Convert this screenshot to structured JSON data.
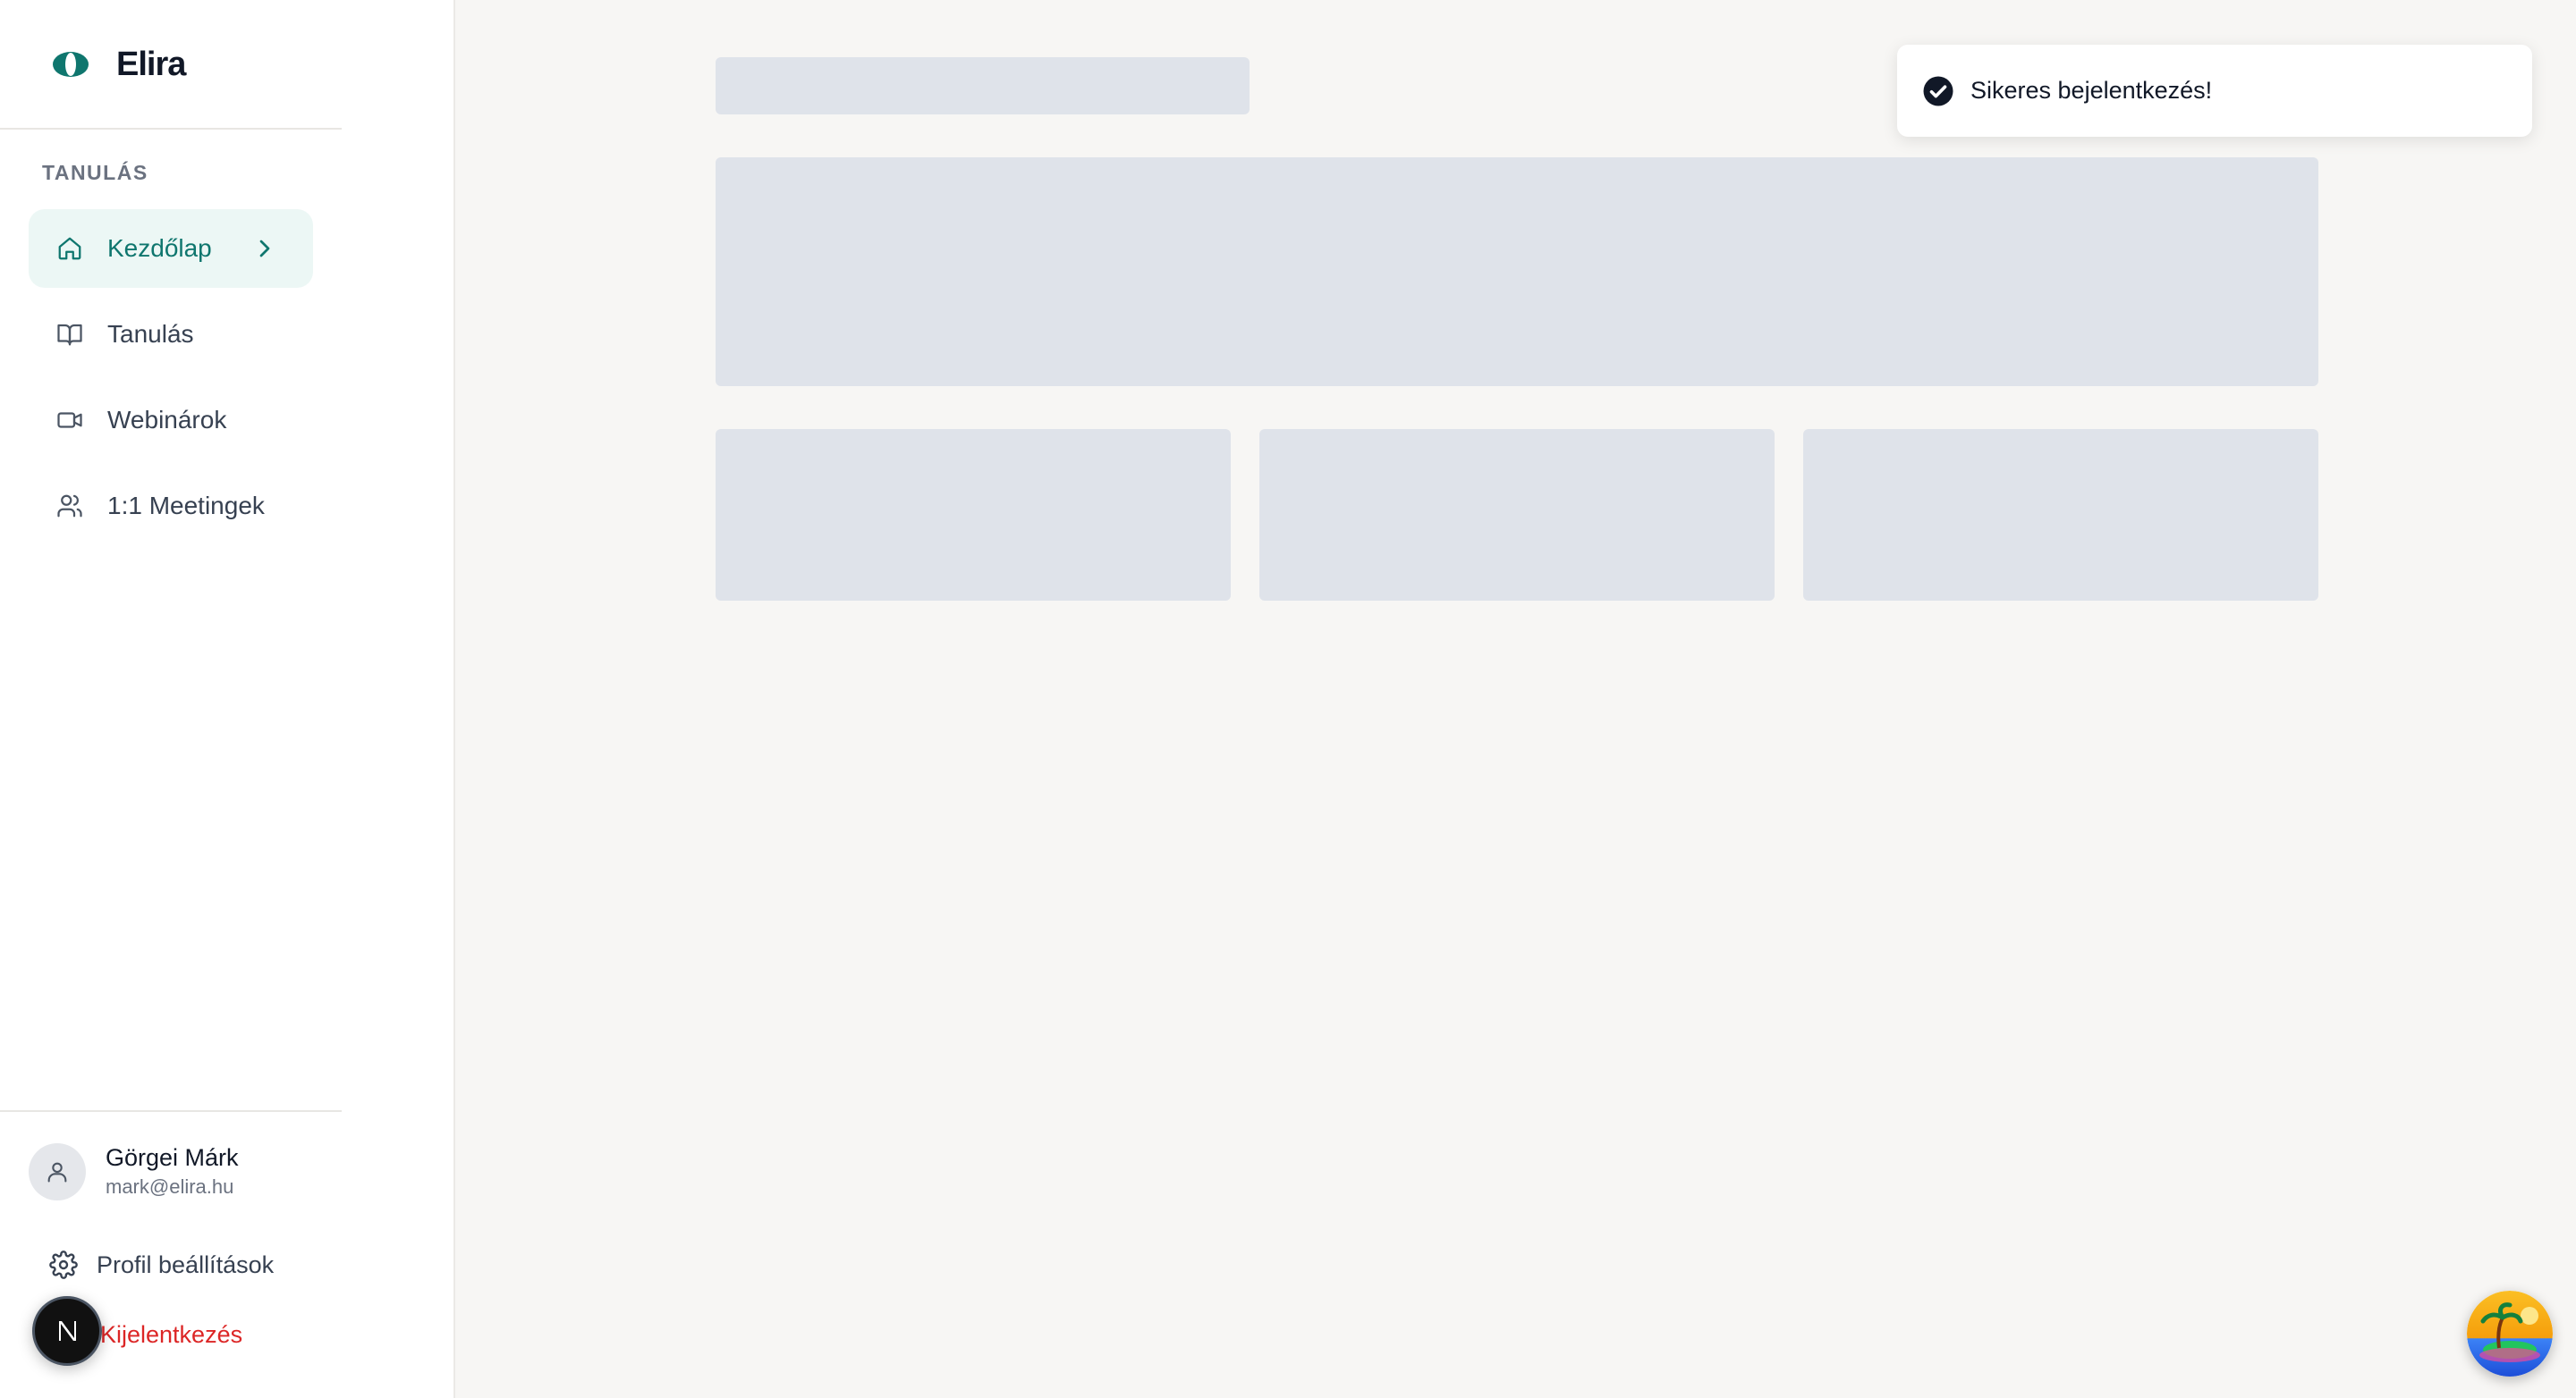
{
  "app": {
    "name": "Elira"
  },
  "sidebar": {
    "section_label": "TANULÁS",
    "items": [
      {
        "label": "Kezdőlap",
        "icon": "home-icon",
        "active": true
      },
      {
        "label": "Tanulás",
        "icon": "book-icon",
        "active": false
      },
      {
        "label": "Webinárok",
        "icon": "video-icon",
        "active": false
      },
      {
        "label": "1:1 Meetingek",
        "icon": "users-icon",
        "active": false
      }
    ],
    "user": {
      "name": "Görgei Márk",
      "email": "mark@elira.hu"
    },
    "settings_label": "Profil beállítások",
    "logout_label": "Kijelentkezés"
  },
  "toast": {
    "message": "Sikeres bejelentkezés!",
    "icon": "check-circle-icon"
  },
  "colors": {
    "accent": "#0f766e",
    "active_bg": "#ecf7f5",
    "danger": "#dc2626",
    "skeleton": "#dfe3ea",
    "background": "#f7f6f4"
  }
}
